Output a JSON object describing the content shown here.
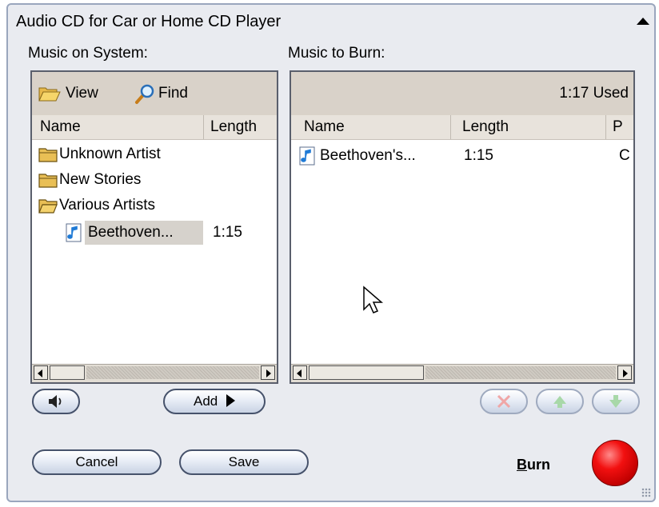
{
  "window": {
    "title": "Audio CD for Car or Home CD Player"
  },
  "left_panel": {
    "label": "Music on System:",
    "toolbar": {
      "view_label": "View",
      "find_label": "Find"
    },
    "columns": [
      "Name",
      "Length"
    ],
    "tree": [
      {
        "type": "folder",
        "name": "Unknown Artist"
      },
      {
        "type": "folder",
        "name": "New Stories"
      },
      {
        "type": "folder",
        "name": "Various Artists"
      },
      {
        "type": "track",
        "name": "Beethoven...",
        "length": "1:15",
        "selected": true
      }
    ]
  },
  "right_panel": {
    "label": "Music to Burn:",
    "used": "1:17 Used",
    "columns": [
      "Name",
      "Length",
      "P"
    ],
    "rows": [
      {
        "name": "Beethoven's...",
        "length": "1:15",
        "p": "C"
      }
    ]
  },
  "buttons": {
    "preview": "speaker-icon",
    "add": "Add",
    "remove": "remove-icon",
    "move_up": "arrow-up-icon",
    "move_down": "arrow-down-icon",
    "cancel": "Cancel",
    "save": "Save",
    "burn": "Burn"
  },
  "colors": {
    "burn_button": "#e60000",
    "panel_toolbar": "#d9d2c9",
    "selected_row": "#d6d2cc"
  }
}
